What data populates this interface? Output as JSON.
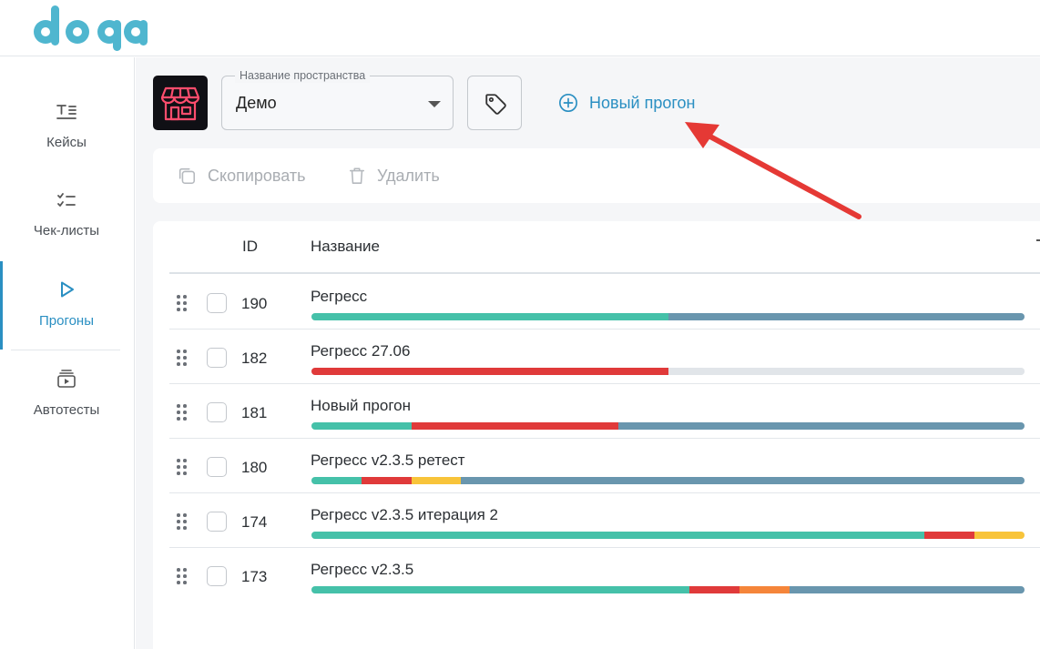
{
  "app": {
    "logo_text": "doqa",
    "logo_color": "#4fb6cf"
  },
  "sidebar": {
    "items": [
      {
        "label": "Кейсы",
        "icon": "test-cases-icon",
        "active": false
      },
      {
        "label": "Чек-листы",
        "icon": "checklist-icon",
        "active": false
      },
      {
        "label": "Прогоны",
        "icon": "play-icon",
        "active": true
      },
      {
        "label": "Автотесты",
        "icon": "autotest-icon",
        "active": false
      }
    ]
  },
  "header": {
    "space_avatar_icon": "storefront-icon",
    "space_select": {
      "label": "Название пространства",
      "value": "Демо"
    },
    "tag_button_icon": "tag-icon",
    "new_run_label": "Новый прогон",
    "new_run_icon": "plus-circle-icon",
    "annotation_arrow_color": "#e53935"
  },
  "toolbar": {
    "copy_label": "Скопировать",
    "delete_label": "Удалить"
  },
  "table": {
    "columns": {
      "id": "ID",
      "name": "Название"
    },
    "status_colors": {
      "passed": "#45c1a9",
      "failed": "#e03a3a",
      "blocked": "#f8c43a",
      "skipped": "#f5853a",
      "untested": "#6996ae",
      "empty": "#e1e5e9"
    },
    "rows": [
      {
        "id": "190",
        "name": "Регресс",
        "progress": [
          {
            "status": "passed",
            "fraction": 0.5
          },
          {
            "status": "untested",
            "fraction": 0.5
          }
        ]
      },
      {
        "id": "182",
        "name": "Регресс 27.06",
        "progress": [
          {
            "status": "failed",
            "fraction": 0.5
          },
          {
            "status": "empty",
            "fraction": 0.5
          }
        ]
      },
      {
        "id": "181",
        "name": "Новый прогон",
        "progress": [
          {
            "status": "passed",
            "fraction": 0.14
          },
          {
            "status": "failed",
            "fraction": 0.29
          },
          {
            "status": "untested",
            "fraction": 0.57
          }
        ]
      },
      {
        "id": "180",
        "name": "Регресс v2.3.5 ретест",
        "progress": [
          {
            "status": "passed",
            "fraction": 0.07
          },
          {
            "status": "failed",
            "fraction": 0.07
          },
          {
            "status": "blocked",
            "fraction": 0.07
          },
          {
            "status": "untested",
            "fraction": 0.79
          }
        ]
      },
      {
        "id": "174",
        "name": "Регресс v2.3.5 итерация 2",
        "progress": [
          {
            "status": "passed",
            "fraction": 0.86
          },
          {
            "status": "failed",
            "fraction": 0.07
          },
          {
            "status": "blocked",
            "fraction": 0.07
          }
        ]
      },
      {
        "id": "173",
        "name": "Регресс v2.3.5",
        "progress": [
          {
            "status": "passed",
            "fraction": 0.53
          },
          {
            "status": "failed",
            "fraction": 0.07
          },
          {
            "status": "skipped",
            "fraction": 0.07
          },
          {
            "status": "untested",
            "fraction": 0.33
          }
        ]
      }
    ]
  }
}
